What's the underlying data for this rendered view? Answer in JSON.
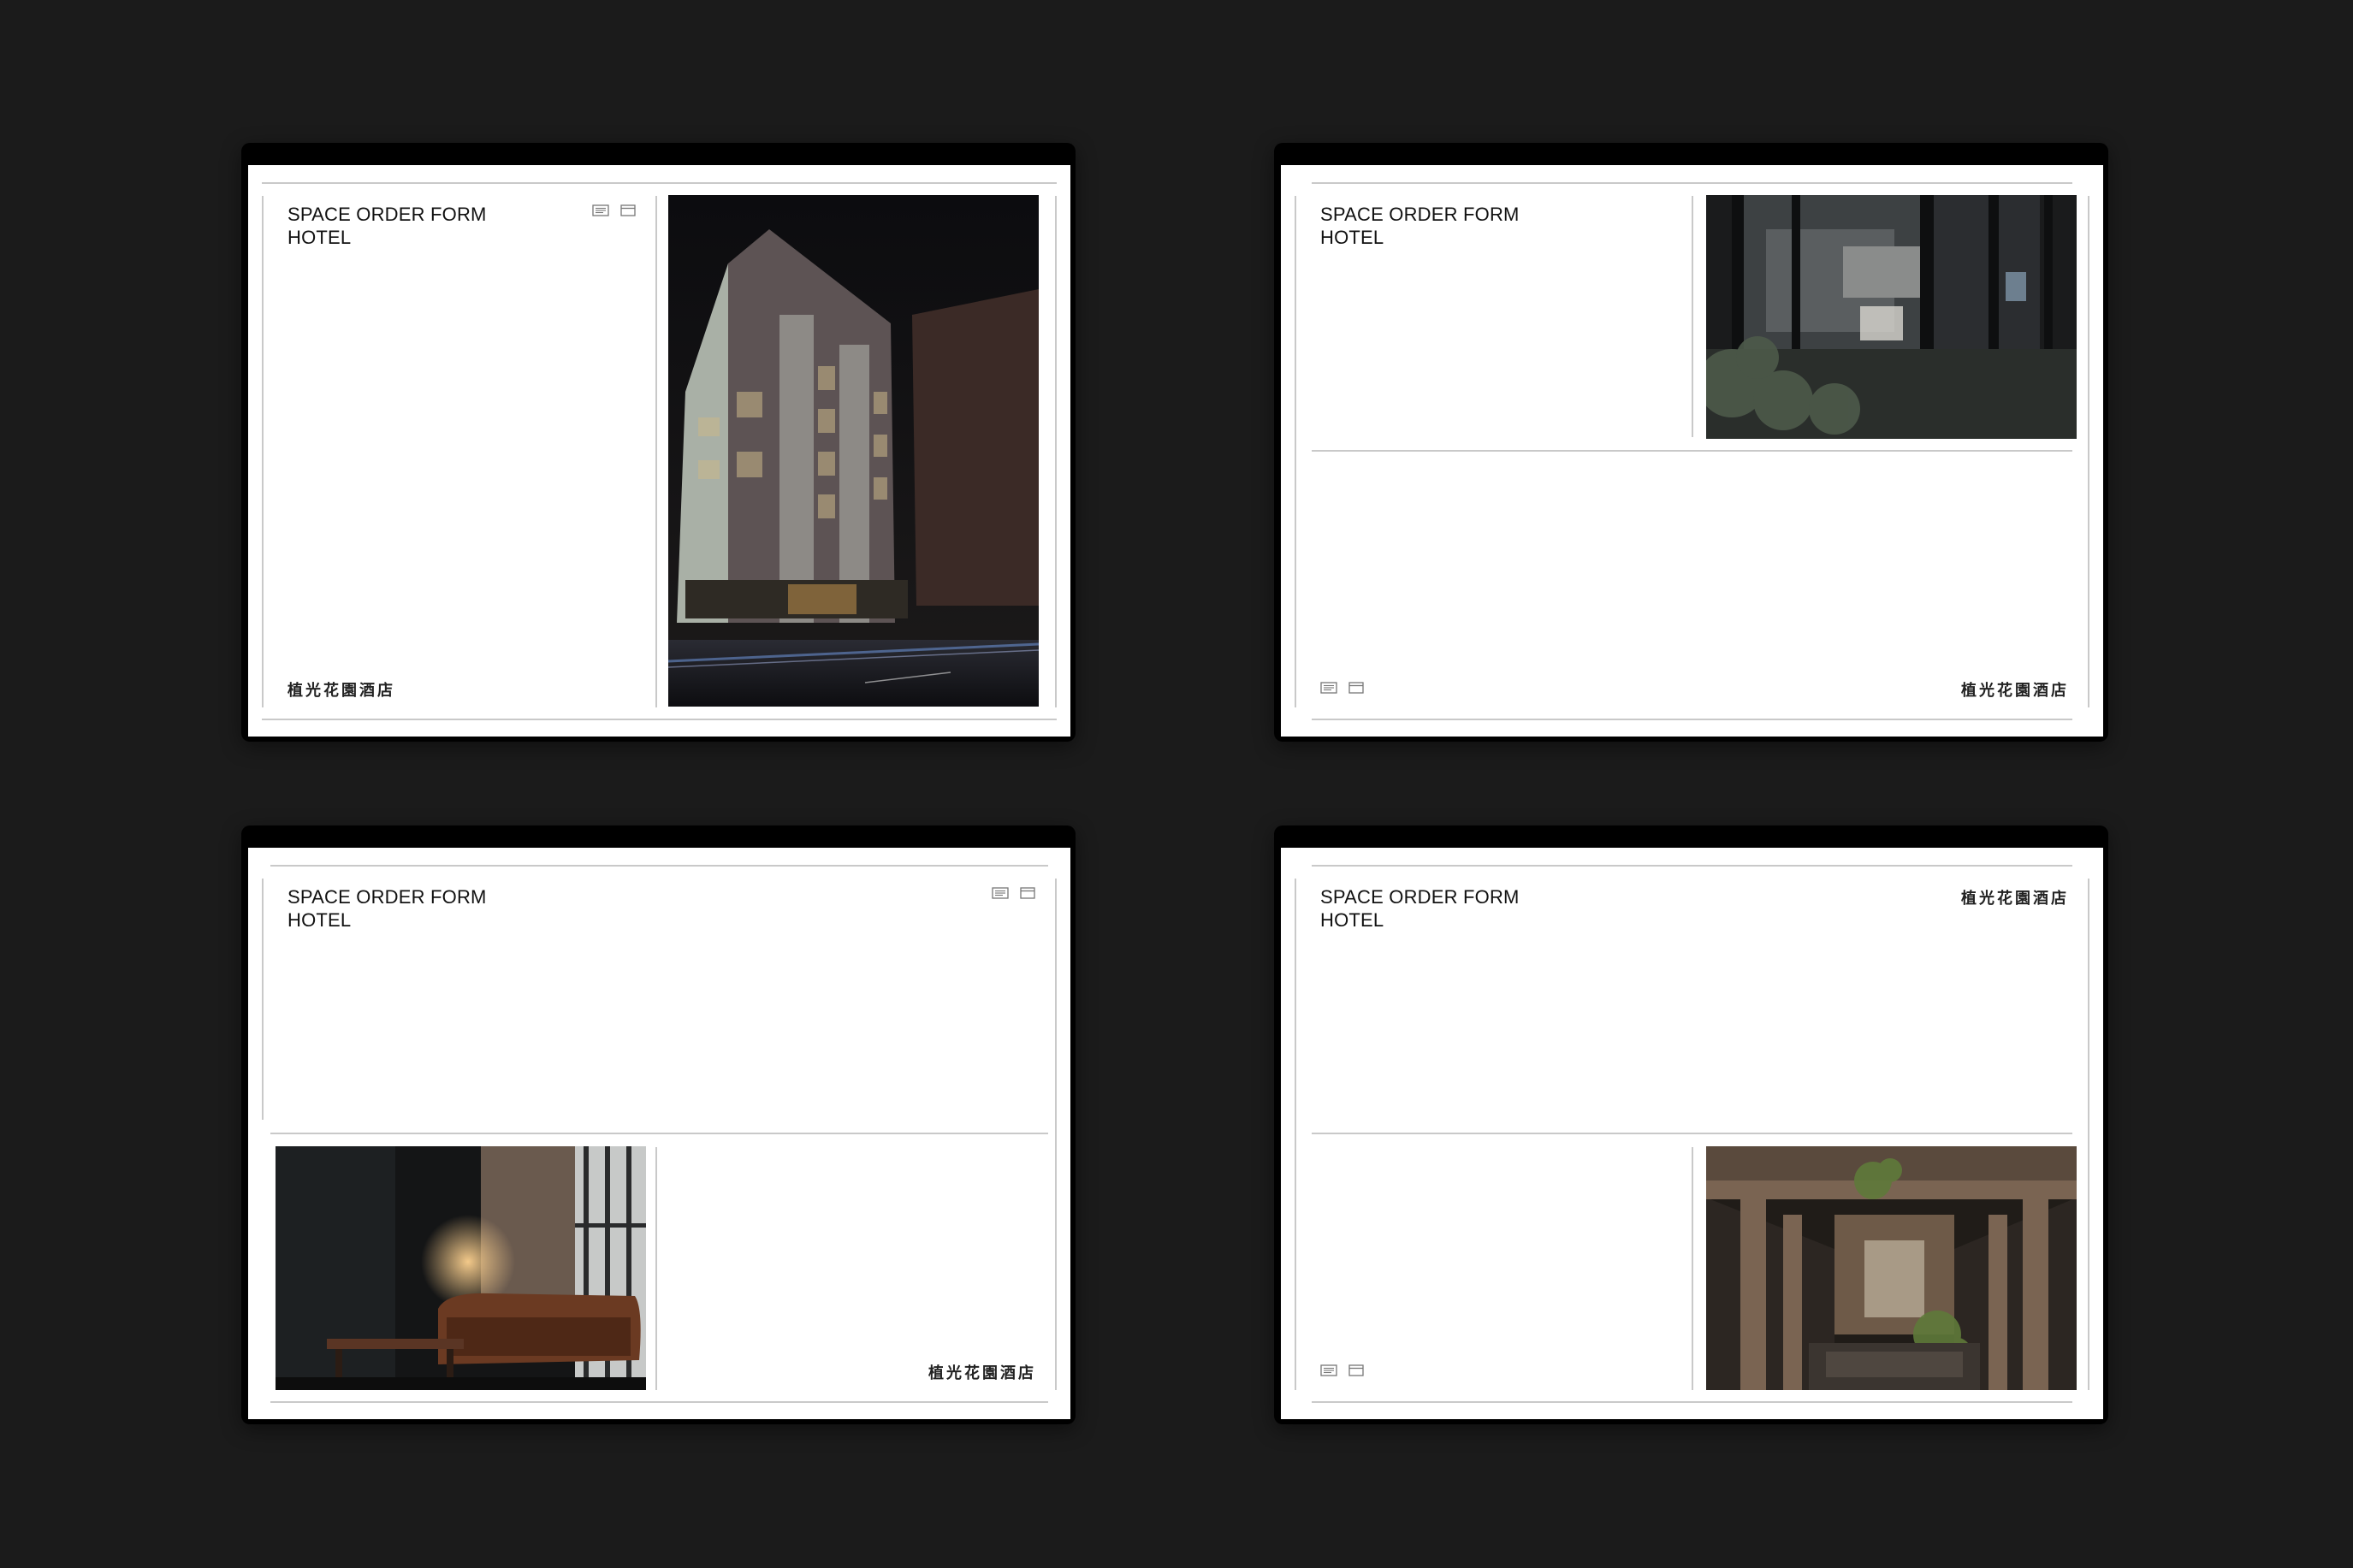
{
  "mockups": [
    {
      "title_line1": "SPACE ORDER FORM",
      "title_line2": "HOTEL",
      "name_cn": "植光花園酒店"
    },
    {
      "title_line1": "SPACE ORDER FORM",
      "title_line2": "HOTEL",
      "name_cn": "植光花園酒店"
    },
    {
      "title_line1": "SPACE ORDER FORM",
      "title_line2": "HOTEL",
      "name_cn": "植光花園酒店"
    },
    {
      "title_line1": "SPACE ORDER FORM",
      "title_line2": "HOTEL",
      "name_cn": "植光花園酒店"
    }
  ],
  "icons": [
    "document-list-icon",
    "calendar-icon"
  ],
  "photos": [
    "hotel-exterior-night",
    "lobby-interior-with-plants",
    "lounge-leather-sofa",
    "atrium-interior"
  ],
  "colors": {
    "background": "#1b1b1b",
    "device": "#000000",
    "paper": "#ffffff",
    "rule": "#c9c9c9",
    "text": "#111111"
  }
}
